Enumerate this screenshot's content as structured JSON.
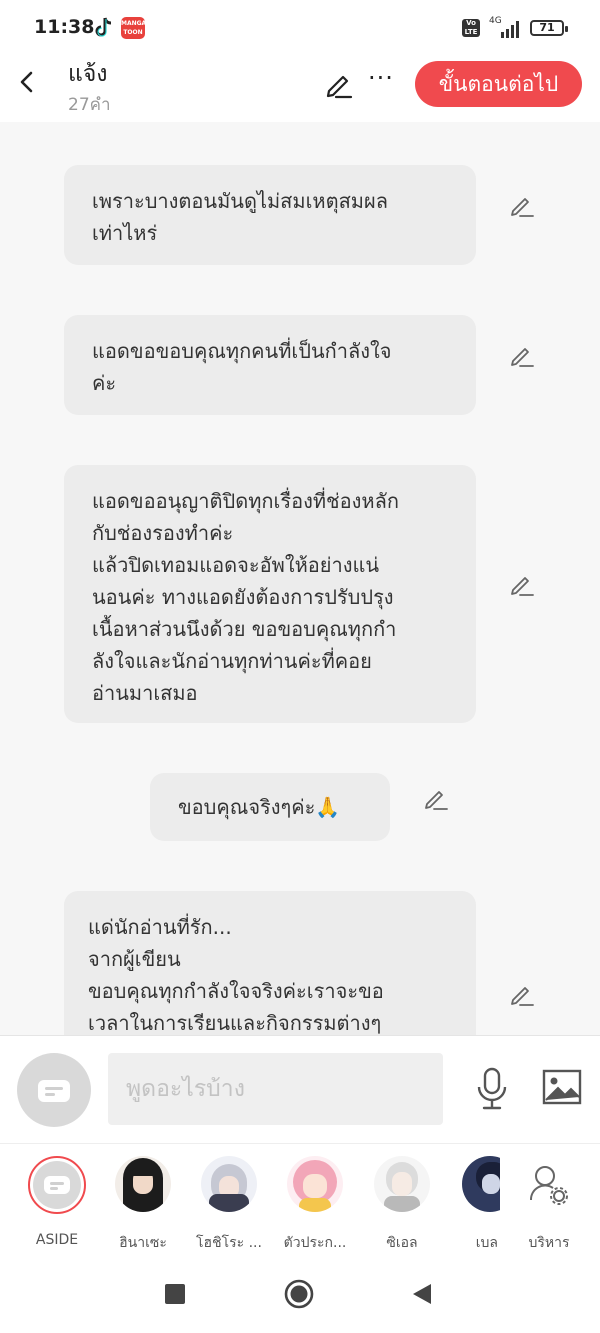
{
  "status": {
    "time": "11:38",
    "battery": "71",
    "network": "4G",
    "volte": "Vo LTE",
    "manga_app": "MANGA TOON"
  },
  "header": {
    "title": "แจ้ง",
    "subtitle": "27คำ",
    "next_label": "ขั้นตอนต่อไป"
  },
  "messages": [
    {
      "text": "เพราะบางตอนมันดูไม่สมเหตุสมผล\nเท่าไหร่"
    },
    {
      "text": "แอดขอขอบคุณทุกคนที่เป็นกำลังใจ\nค่ะ"
    },
    {
      "text": "แอดขออนุญาติปิดทุกเรื่องที่ช่องหลัก\nกับช่องรองทำค่ะ\nแล้วปิดเทอมแอดจะอัพให้อย่างแน่\nนอนค่ะ ทางแอดยังต้องการปรับปรุง\nเนื้อหาส่วนนึงด้วย ขอขอบคุณทุกกำ\nลังใจและนักอ่านทุกท่านค่ะที่คอย\nอ่านมาเสมอ"
    },
    {
      "text": "ขอบคุณจริงๆค่ะ🙏"
    },
    {
      "text": "แด่นักอ่านที่รัก...\nจากผู้เขียน\nขอบคุณทุกกำลังใจจริงค่ะเราจะขอ\nเวลาในการเรียนและกิจกรรมต่างๆ"
    }
  ],
  "composer": {
    "placeholder": "พูดอะไรบ้าง"
  },
  "characters": [
    {
      "label": "ASIDE"
    },
    {
      "label": "ฮินาเซะ"
    },
    {
      "label": "โฮชิโระ ..."
    },
    {
      "label": "ตัวประก..."
    },
    {
      "label": "ซิเอล"
    },
    {
      "label": "เบล"
    },
    {
      "label": "บริหาร"
    }
  ]
}
